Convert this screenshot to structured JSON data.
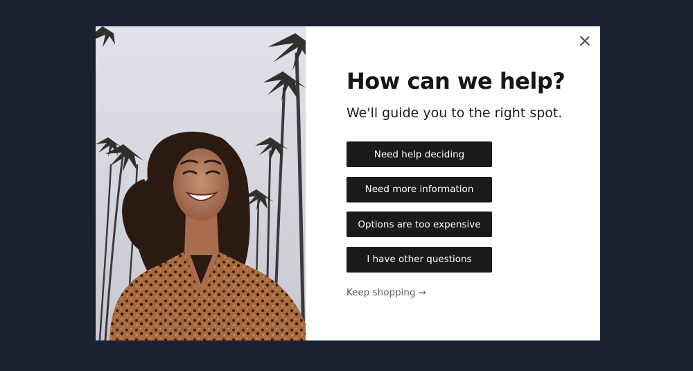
{
  "colors": {
    "backdrop": "#1b2033",
    "modal_background": "#ffffff",
    "button_background": "#1a1a1a",
    "button_text": "#ffffff",
    "title_text": "#161616",
    "link_text": "#5a5c66"
  },
  "modal": {
    "close_icon": "close-icon",
    "title": "How can we help?",
    "subtitle": "We'll guide you to the right spot.",
    "options": [
      {
        "label": "Need help deciding"
      },
      {
        "label": "Need more information"
      },
      {
        "label": "Options are too expensive"
      },
      {
        "label": "I have other questions"
      }
    ],
    "keep_shopping": "Keep shopping →"
  }
}
